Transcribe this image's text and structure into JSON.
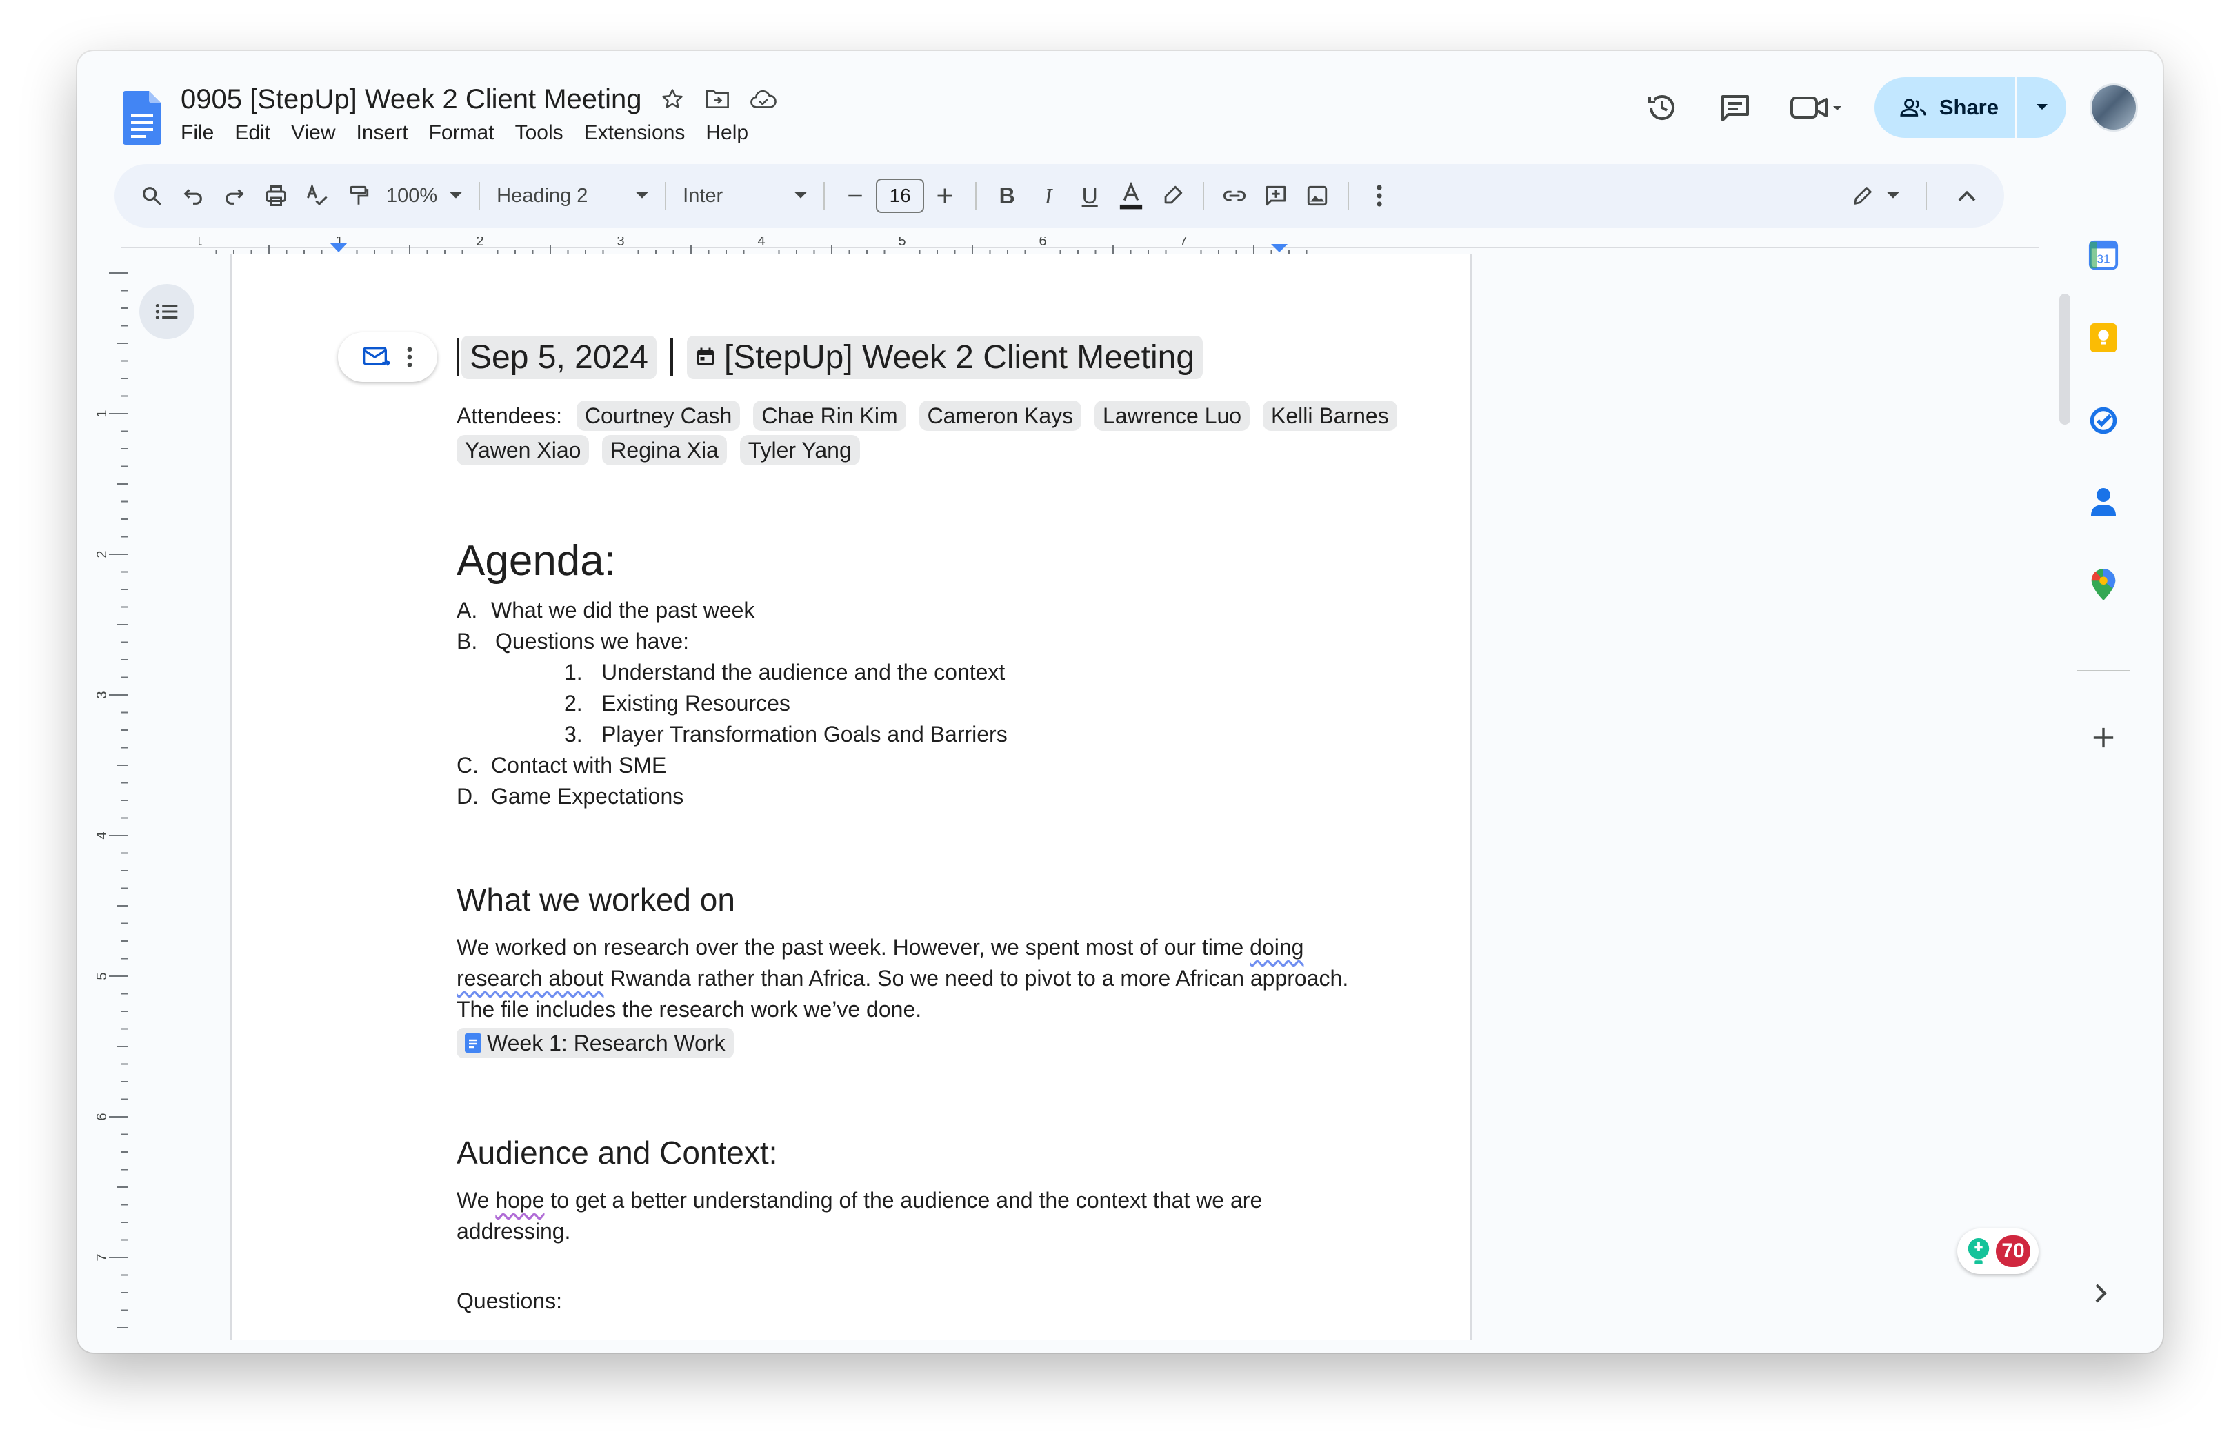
{
  "doc": {
    "title": "0905 [StepUp] Week 2 Client Meeting"
  },
  "menu": [
    "File",
    "Edit",
    "View",
    "Insert",
    "Format",
    "Tools",
    "Extensions",
    "Help"
  ],
  "share": {
    "label": "Share"
  },
  "toolbar": {
    "zoom": "100%",
    "style": "Heading 2",
    "font": "Inter",
    "font_size": "16"
  },
  "ruler": {
    "h_numbers": [
      "1",
      "1",
      "2",
      "3",
      "4",
      "5",
      "6",
      "7"
    ],
    "v_numbers": [
      "1",
      "2",
      "3",
      "4",
      "5",
      "6",
      "7"
    ]
  },
  "content": {
    "date_chip": "Sep 5, 2024",
    "event_chip": "[StepUp] Week 2 Client Meeting",
    "attendees_label": "Attendees:",
    "attendees": [
      "Courtney Cash",
      "Chae Rin Kim",
      "Cameron Kays",
      "Lawrence Luo",
      "Kelli Barnes",
      "Yawen Xiao",
      "Regina Xia",
      "Tyler Yang"
    ],
    "agenda_title": "Agenda:",
    "agenda": [
      {
        "marker": "A.",
        "text": "What we did the past week"
      },
      {
        "marker": "B.",
        "text": "Questions we have:"
      }
    ],
    "agenda_sub": [
      {
        "marker": "1.",
        "text": "Understand the audience and the context"
      },
      {
        "marker": "2.",
        "text": "Existing Resources"
      },
      {
        "marker": "3.",
        "text": "Player Transformation Goals and Barriers"
      }
    ],
    "agenda_rest": [
      {
        "marker": "C.",
        "text": "Contact with SME"
      },
      {
        "marker": "D.",
        "text": "Game Expectations"
      }
    ],
    "worked_title": "What we worked on",
    "worked_p1_a": "We worked on research over the past week. However, we spent most of our time ",
    "worked_p1_squig": "doing research about",
    "worked_p1_b": " Rwanda rather than Africa.  So we need to pivot to a more African approach.",
    "worked_p2": "The file includes the research work we’ve done.",
    "file_chip": "Week 1: Research Work",
    "audience_title": "Audience and Context:",
    "audience_p_a": "We ",
    "audience_p_squig": "hope",
    "audience_p_b": " to get a better understanding of the audience and the context that we are addressing.",
    "questions_label": "Questions:"
  },
  "badge": {
    "count": "70"
  },
  "icons": {
    "calendar_day": "31",
    "colors": {
      "docs_blue": "#4285f4",
      "share_bg": "#c2e7ff",
      "badge_red": "#d0273f"
    }
  }
}
